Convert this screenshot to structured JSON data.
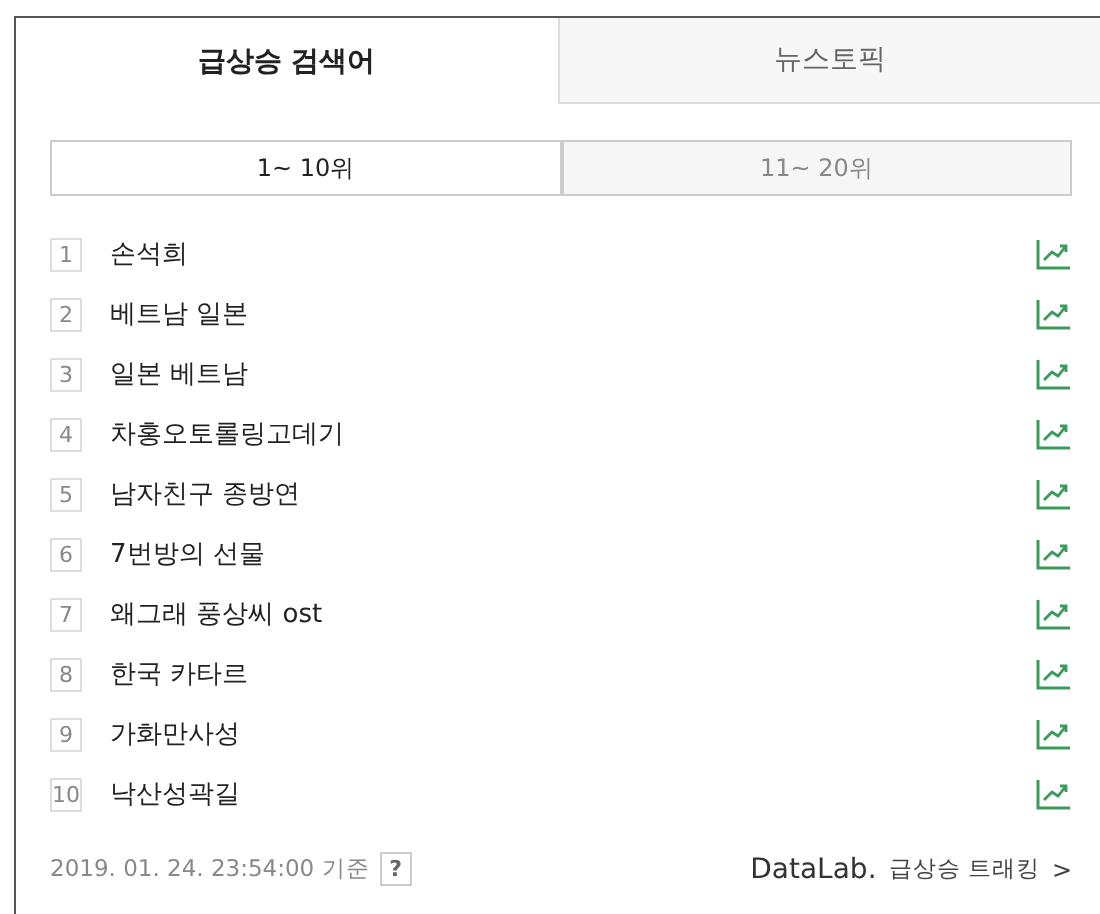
{
  "tabs": [
    {
      "label": "급상승 검색어",
      "selected": true
    },
    {
      "label": "뉴스토픽",
      "selected": false
    }
  ],
  "range_tabs": [
    {
      "label": "1~ 10위",
      "selected": true
    },
    {
      "label": "11~ 20위",
      "selected": false
    }
  ],
  "keywords": [
    {
      "rank": "1",
      "text": "손석희"
    },
    {
      "rank": "2",
      "text": "베트남 일본"
    },
    {
      "rank": "3",
      "text": "일본 베트남"
    },
    {
      "rank": "4",
      "text": "차홍오토롤링고데기"
    },
    {
      "rank": "5",
      "text": "남자친구 종방연"
    },
    {
      "rank": "6",
      "text": "7번방의 선물"
    },
    {
      "rank": "7",
      "text": "왜그래 풍상씨 ost"
    },
    {
      "rank": "8",
      "text": "한국 카타르"
    },
    {
      "rank": "9",
      "text": "가화만사성"
    },
    {
      "rank": "10",
      "text": "낙산성곽길"
    }
  ],
  "footer": {
    "timestamp": "2019. 01. 24. 23:54:00 기준",
    "help": "?",
    "brand": "DataLab.",
    "link": "급상승 트래킹",
    "link_arrow": ">"
  }
}
